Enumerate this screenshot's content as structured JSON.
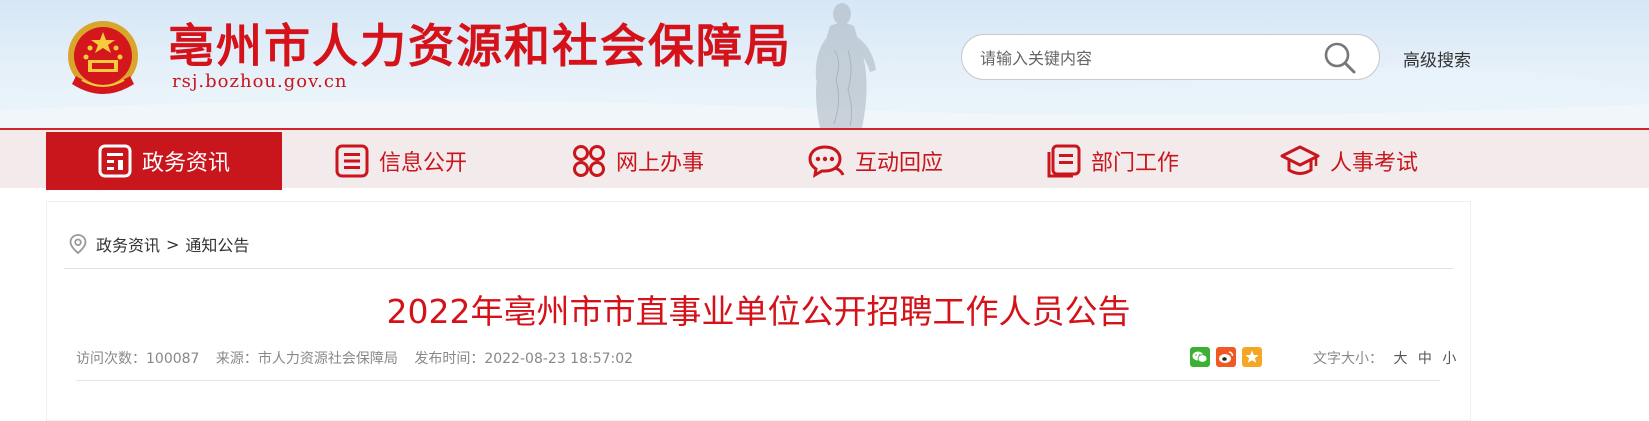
{
  "header": {
    "site_title": "亳州市人力资源和社会保障局",
    "site_url": "rsj.bozhou.gov.cn",
    "search_placeholder": "请输入关键内容",
    "advanced_search": "高级搜索"
  },
  "nav": {
    "items": [
      {
        "label": "政务资讯",
        "icon": "news-icon",
        "active": true
      },
      {
        "label": "信息公开",
        "icon": "document-list-icon",
        "active": false
      },
      {
        "label": "网上办事",
        "icon": "apps-grid-icon",
        "active": false
      },
      {
        "label": "互动回应",
        "icon": "chat-bubble-icon",
        "active": false
      },
      {
        "label": "部门工作",
        "icon": "files-icon",
        "active": false
      },
      {
        "label": "人事考试",
        "icon": "graduation-cap-icon",
        "active": false
      }
    ]
  },
  "breadcrumb": {
    "items": [
      "政务资讯",
      "通知公告"
    ],
    "separator": ">"
  },
  "article": {
    "title": "2022年亳州市市直事业单位公开招聘工作人员公告",
    "visits": "访问次数：100087",
    "source": "来源：市人力资源社会保障局",
    "published": "发布时间：2022-08-23 18:57:02",
    "font_size_label": "文字大小：",
    "font_size_options": [
      "大",
      "中",
      "小"
    ]
  },
  "share": [
    "wechat-icon",
    "weibo-icon",
    "favorite-icon"
  ],
  "colors": {
    "brand_red": "#c9161d",
    "nav_bg": "#f2eaeb",
    "header_bg": "#dceaf7"
  }
}
